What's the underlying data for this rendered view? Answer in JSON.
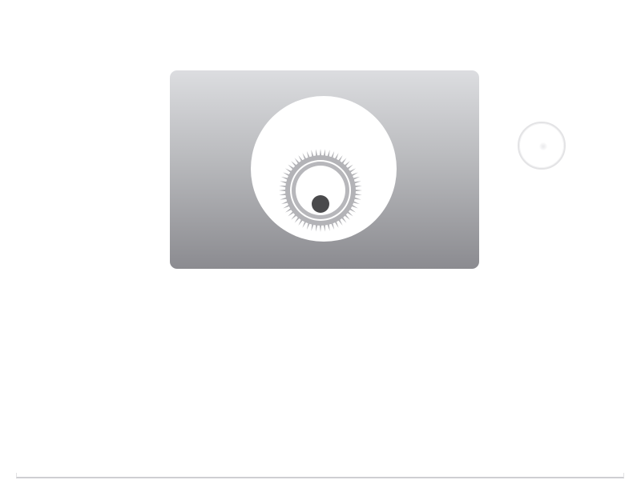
{
  "colors": {
    "card_top": "#dcdde0",
    "card_bottom": "#8b8b90",
    "lens_face": "#ffffff",
    "gear_ring": "#b3b3b7",
    "pupil": "#4a4a4c",
    "button_border": "#e3e3e5",
    "rule": "#cfcfd2"
  },
  "icons": {
    "main": "camera-lens-icon",
    "gear": "gear-ring-icon",
    "pupil": "pupil-dot-icon",
    "button": "circle-button-icon"
  }
}
